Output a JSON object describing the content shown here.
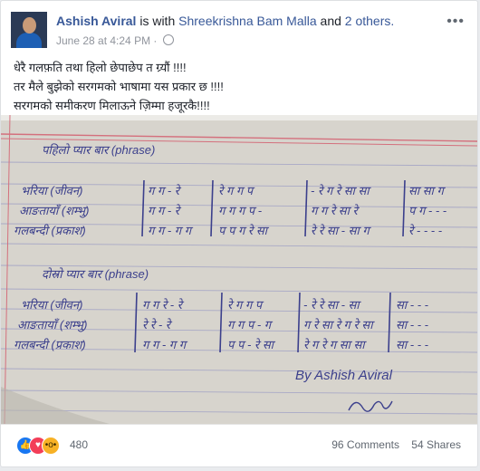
{
  "header": {
    "author": "Ashish Aviral",
    "with_text": "is with",
    "tagged": "Shreekrishna Bam Malla",
    "and_text": "and",
    "others": "2 others.",
    "date": "June 28 at 4:24 PM",
    "separator": "·"
  },
  "post_text": [
    "धेरै गलफ़ति तथा हिलो छेपाछेप त ग्र्यौं !!!!",
    "तर मैले बुझेको सरगमको भाषामा यस प्रकार छ !!!!",
    "सरगमको समीकरण मिलाऊने ज़िम्मा हजूरकै!!!!"
  ],
  "photo": {
    "heading1": "पहिलो प्यार बार (phrase)",
    "rows1": [
      {
        "label": "भरिया (जीवन)",
        "cells": [
          "ग ग - रे",
          "रे ग ग प",
          "- रे ग रे सा सा",
          "सा सा ग"
        ]
      },
      {
        "label": "आङतायाँ (शम्भु)",
        "cells": [
          "ग ग - रे",
          "ग ग ग प -",
          "ग ग रे सा रे",
          "प ग - - -"
        ]
      },
      {
        "label": "गलबन्दी (प्रकाश)",
        "cells": [
          "ग ग - ग ग",
          "प प ग रे सा",
          "रे रे सा - सा ग",
          "रे - - - -"
        ]
      }
    ],
    "heading2": "दोस्रो प्यार बार (phrase)",
    "rows2": [
      {
        "label": "भरिया (जीवन)",
        "cells": [
          "ग ग रे - रे",
          "रे ग ग प",
          "- रे रे सा - सा",
          "सा - - -"
        ]
      },
      {
        "label": "आङतायाँ (शम्भु)",
        "cells": [
          "रे रे - रे",
          "ग ग प - ग",
          "ग रे सा रे ग रे सा",
          "सा - - -"
        ]
      },
      {
        "label": "गलबन्दी (प्रकाश)",
        "cells": [
          "ग ग - ग ग",
          "प प - रे सा",
          "रे ग रे ग सा सा",
          "सा - - -"
        ]
      }
    ],
    "signature": "By Ashish Aviral"
  },
  "reactions": {
    "count": "480",
    "types": [
      "like-icon",
      "love-icon",
      "wow-icon"
    ]
  },
  "stats": {
    "comments": "96 Comments",
    "shares": "54 Shares"
  },
  "colors": {
    "link": "#385898",
    "muted": "#90949c",
    "ink": "#3b3f8c"
  }
}
